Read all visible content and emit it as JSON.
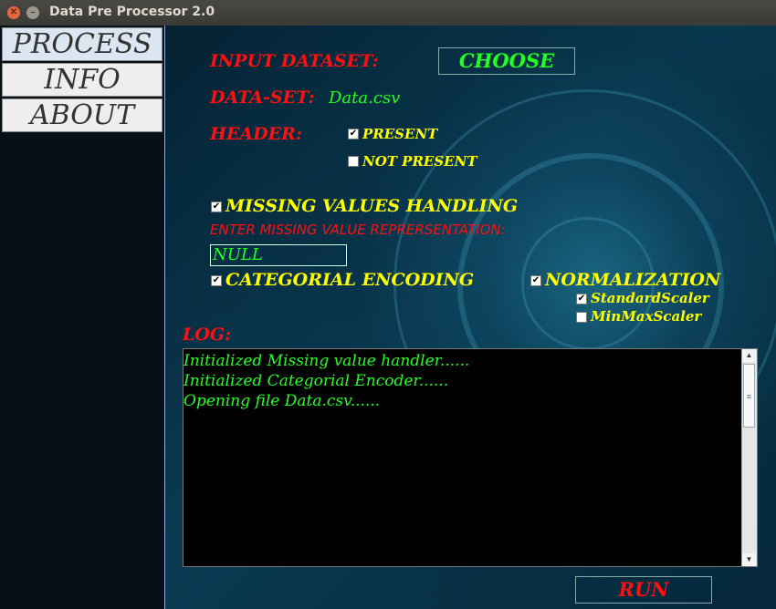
{
  "window": {
    "title": "Data Pre Processor 2.0",
    "close_glyph": "✕",
    "minimize_glyph": "–"
  },
  "sidebar": {
    "tabs": [
      {
        "label": "PROCESS"
      },
      {
        "label": "INFO"
      },
      {
        "label": "ABOUT"
      }
    ],
    "active": "PROCESS"
  },
  "form": {
    "input_dataset_label": "INPUT DATASET:",
    "choose_label": "CHOOSE",
    "dataset_label": "DATA-SET:",
    "dataset_value": "Data.csv",
    "header_label": "HEADER:",
    "header_present_label": "PRESENT",
    "header_present_checked": true,
    "header_not_present_label": "NOT PRESENT",
    "header_not_present_checked": false,
    "missing_label": "MISSING VALUES HANDLING",
    "missing_checked": true,
    "missing_repr_label": "ENTER MISSING VALUE REPRERSENTATION:",
    "missing_repr_value": "NULL",
    "categorial_label": "CATEGORIAL ENCODING",
    "categorial_checked": true,
    "normalization_label": "NORMALIZATION",
    "normalization_checked": true,
    "standard_scaler_label": "StandardScaler",
    "standard_scaler_checked": true,
    "minmax_scaler_label": "MinMaxScaler",
    "minmax_scaler_checked": false
  },
  "log": {
    "label": "LOG:",
    "lines": [
      "Initialized Missing value handler......",
      "Initialized Categorial Encoder......",
      "Opening file Data.csv......"
    ]
  },
  "run_label": "RUN",
  "colors": {
    "label_red": "#ff1010",
    "label_yellow": "#ffff00",
    "value_green": "#22ff22"
  }
}
